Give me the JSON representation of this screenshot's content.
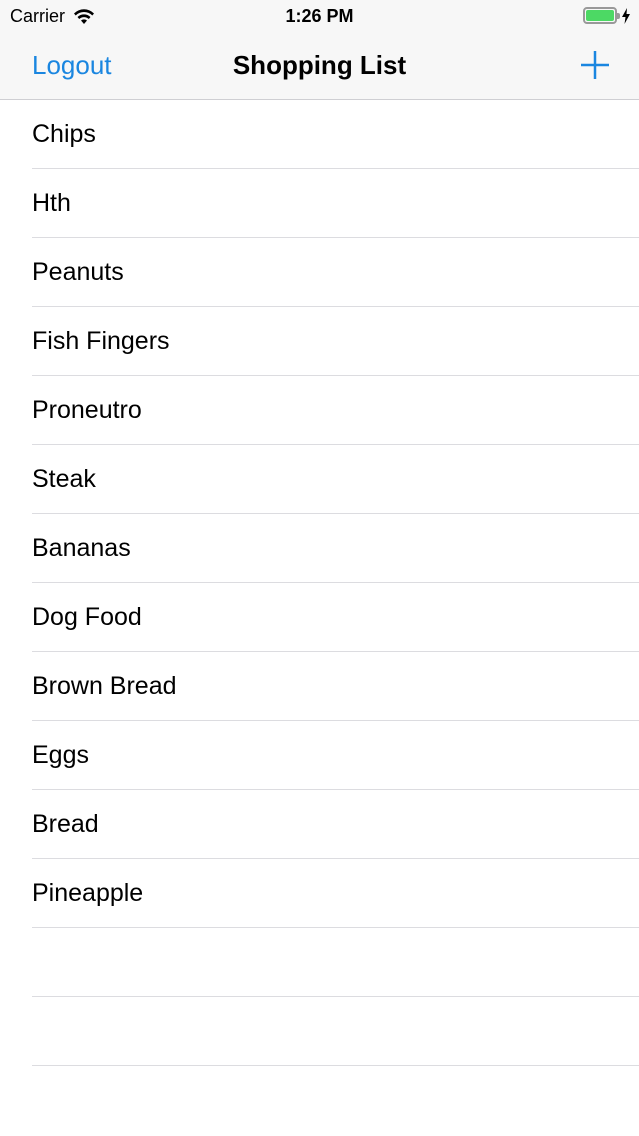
{
  "status": {
    "carrier": "Carrier",
    "time": "1:26 PM",
    "battery_level": 1.0,
    "battery_color": "#4cd964"
  },
  "nav": {
    "left_label": "Logout",
    "title": "Shopping List",
    "add_icon": "plus-icon",
    "accent": "#1a86e0"
  },
  "items": [
    {
      "label": "Chips"
    },
    {
      "label": "Hth"
    },
    {
      "label": "Peanuts"
    },
    {
      "label": "Fish Fingers"
    },
    {
      "label": "Proneutro"
    },
    {
      "label": "Steak"
    },
    {
      "label": "Bananas"
    },
    {
      "label": "Dog Food"
    },
    {
      "label": "Brown Bread"
    },
    {
      "label": "Eggs"
    },
    {
      "label": "Bread"
    },
    {
      "label": "Pineapple"
    }
  ]
}
